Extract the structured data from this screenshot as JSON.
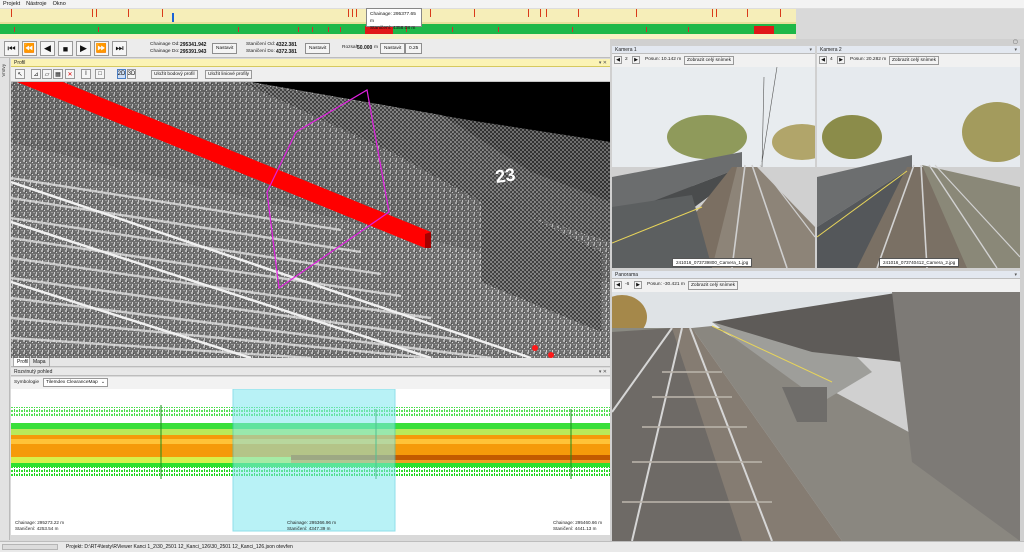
{
  "menu": [
    "Projekt",
    "Nástroje",
    "Okno"
  ],
  "timeline": {
    "tooltip_line1": "Chainage: 295377.65 m",
    "tooltip_line2": "Staničení: 4358.08 m"
  },
  "toolbar": {
    "chainage_from_label": "Chainage Od:",
    "chainage_from_value": "295341.942",
    "chainage_to_label": "Chainage Do:",
    "chainage_to_value": "295391.943",
    "set_label": "Nastavit",
    "station_from_label": "Staničení Od:",
    "station_from_value": "4322.381",
    "station_to_label": "Staničení Do:",
    "station_to_value": "4372.381",
    "set2_label": "Nastavit",
    "range_label": "Rozsah",
    "range_value": "50.000",
    "range_unit": "m",
    "set3_label": "Nastavit",
    "step_value": "0.25"
  },
  "profile_panel": {
    "title": "Profil",
    "btn_2d": "2D",
    "btn_3d": "3D",
    "save_point": "Uložit bodový profil",
    "save_line": "Uložit liniové profily",
    "marker": "23",
    "tabs": [
      "Profil",
      "Mapa"
    ]
  },
  "detail_panel": {
    "title": "Rozvinutý pohled",
    "symbology_label": "Symbologie",
    "symbology_value": "TileIndex ClearanceMap",
    "left_chainage": "Chainage: 295273.22 m",
    "left_station": "Staničení: 4253.54 m",
    "mid_chainage": "Chainage: 295366.96 m",
    "mid_station": "Staničení: 4347.39 m",
    "right_chainage": "Chainage: 295460.66 m",
    "right_station": "Staničení: 4441.13 m"
  },
  "camera1": {
    "title": "Kamera 1",
    "index": "2",
    "shift": "Posun: 10.142 m",
    "show_btn": "Zobrazit celý snímek",
    "caption": "241016_073739800_Camera_1.jpg"
  },
  "camera2": {
    "title": "Kamera 2",
    "index": "4",
    "shift": "Posun: 20.282 m",
    "show_btn": "Zobrazit celý snímek",
    "caption": "241016_073740412_Camera_2.jpg"
  },
  "panorama": {
    "title": "Panorama",
    "index": "-6",
    "shift": "Posun: -30.421 m",
    "show_btn": "Zobrazit celý snímek"
  },
  "sidebar": {
    "label": "Vrstvy"
  },
  "status": {
    "project_text": "Projekt: D:\\RT4\\testy\\RViewer Kanci 1_2\\30_2501 12_Kanci_126\\30_2501 12_Kanci_126.json otevřen"
  },
  "colors": {
    "accent_red": "#ff0000",
    "clearance_orange": "#f59a0a",
    "clearance_green": "#22dd22",
    "selection_cyan": "#7fe8f0",
    "title_yellow": "#fbf3b5"
  }
}
